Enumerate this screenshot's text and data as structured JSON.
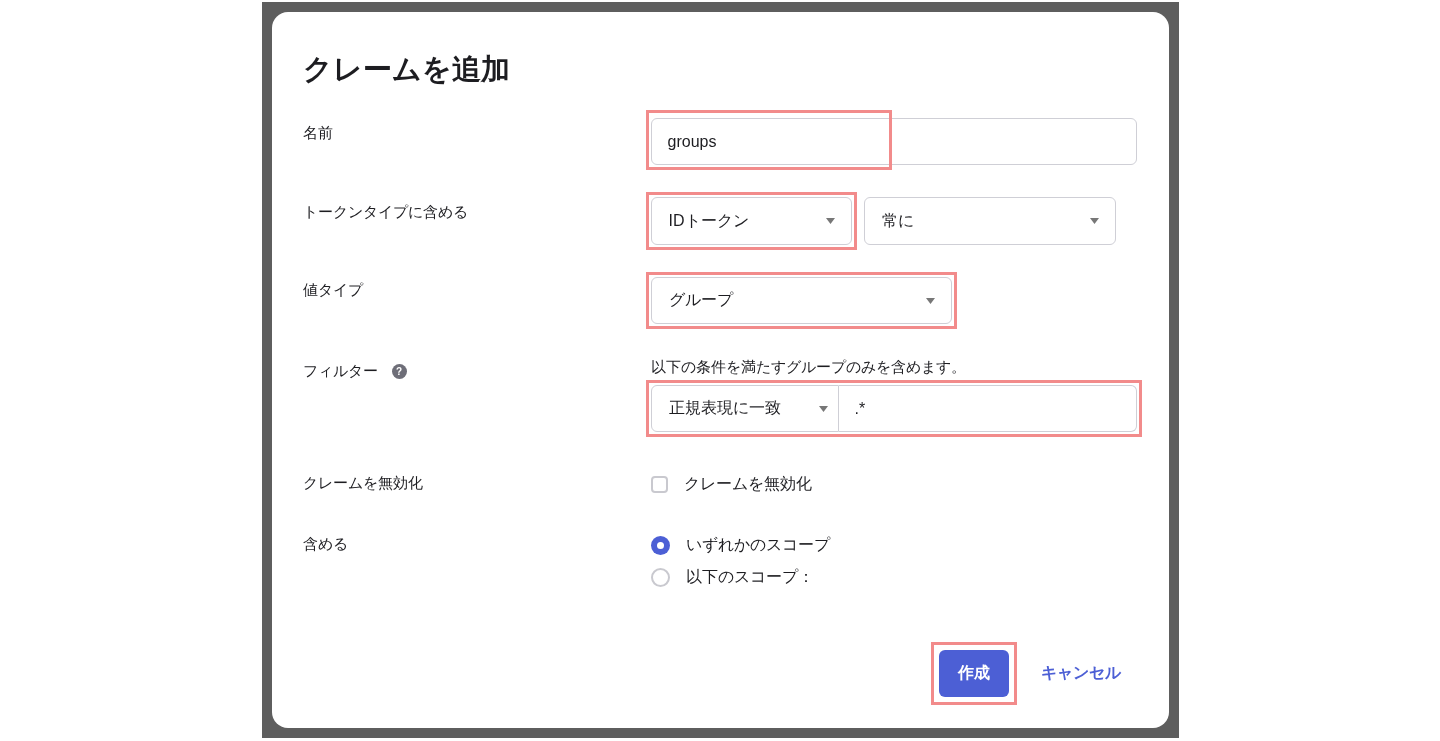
{
  "dialog": {
    "title": "クレームを追加",
    "rows": [
      {
        "kind": "text",
        "label": "名前",
        "value": "groups",
        "highlighted": true
      },
      {
        "kind": "selects",
        "label": "トークンタイプに含める",
        "selects": [
          {
            "value": "IDトークン",
            "highlighted": true
          },
          {
            "value": "常に",
            "highlighted": false
          }
        ]
      },
      {
        "kind": "select",
        "label": "値タイプ",
        "value": "グループ",
        "highlighted": true
      },
      {
        "kind": "filter",
        "label": "フィルター",
        "help": "?",
        "hint": "以下の条件を満たすグループのみを含めます。",
        "operator": "正規表現に一致",
        "value": ".*",
        "highlighted": true
      },
      {
        "kind": "checkbox",
        "label": "クレームを無効化",
        "option": "クレームを無効化",
        "checked": false
      },
      {
        "kind": "radios",
        "label": "含める",
        "options": [
          {
            "label": "いずれかのスコープ",
            "selected": true
          },
          {
            "label": "以下のスコープ：",
            "selected": false
          }
        ]
      }
    ],
    "buttons": {
      "primary": {
        "label": "作成",
        "highlighted": true
      },
      "cancel": {
        "label": "キャンセル"
      }
    }
  }
}
